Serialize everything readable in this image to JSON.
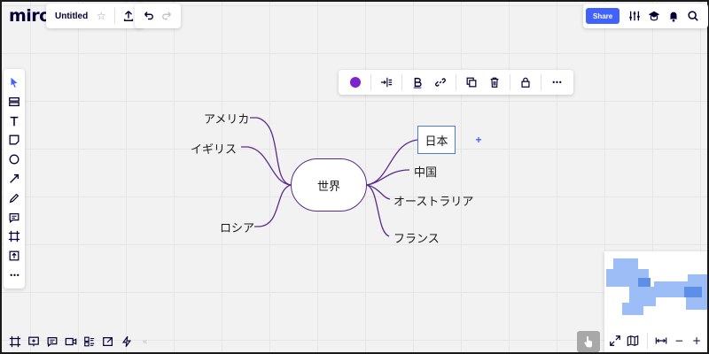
{
  "app": {
    "logo": "miro",
    "board_title": "Untitled"
  },
  "header": {
    "share_label": "Share"
  },
  "mindmap": {
    "center": "世界",
    "left_nodes": [
      "アメリカ",
      "イギリス",
      "ロシア"
    ],
    "right_nodes": [
      "中国",
      "オーストラリア",
      "フランス"
    ],
    "selected_node": "日本",
    "line_color": "#5b2a8c"
  },
  "context_toolbar": {
    "color": "#7e22ce"
  },
  "icons": {
    "star": "☆",
    "upload": "⇧",
    "undo": "↶",
    "redo": "↷",
    "more": "•••",
    "collapse": "«",
    "plus": "+",
    "minus": "−"
  },
  "colors": {
    "accent": "#4262ff",
    "selection": "#4a7bd6"
  }
}
